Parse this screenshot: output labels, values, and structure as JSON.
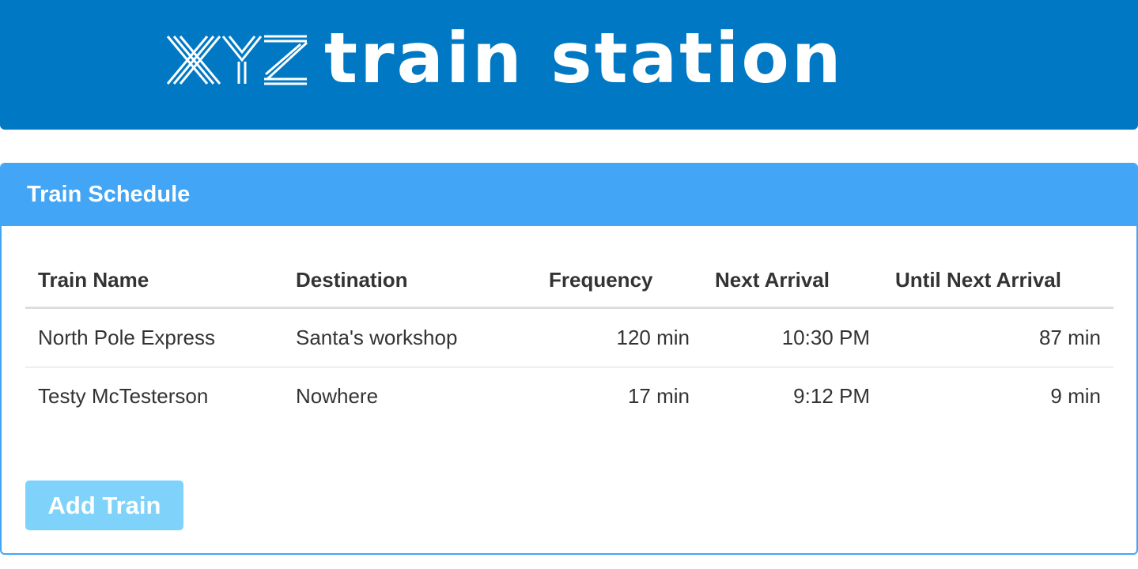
{
  "header": {
    "logo_text": "XYZ train station",
    "colors": {
      "banner": "#0078c4",
      "logo": "#ffffff"
    }
  },
  "panel": {
    "title": "Train Schedule",
    "colors": {
      "heading": "#42a5f5",
      "border": "#42a5f5"
    }
  },
  "table": {
    "columns": [
      "Train Name",
      "Destination",
      "Frequency",
      "Next Arrival",
      "Until Next Arrival"
    ],
    "rows": [
      {
        "name": "North Pole Express",
        "destination": "Santa's workshop",
        "frequency": "120 min",
        "next_arrival": "10:30 PM",
        "until_next": "87 min"
      },
      {
        "name": "Testy McTesterson",
        "destination": "Nowhere",
        "frequency": "17 min",
        "next_arrival": "9:12 PM",
        "until_next": "9 min"
      }
    ]
  },
  "actions": {
    "add_label": "Add Train",
    "colors": {
      "button": "#7fd3fb"
    }
  }
}
